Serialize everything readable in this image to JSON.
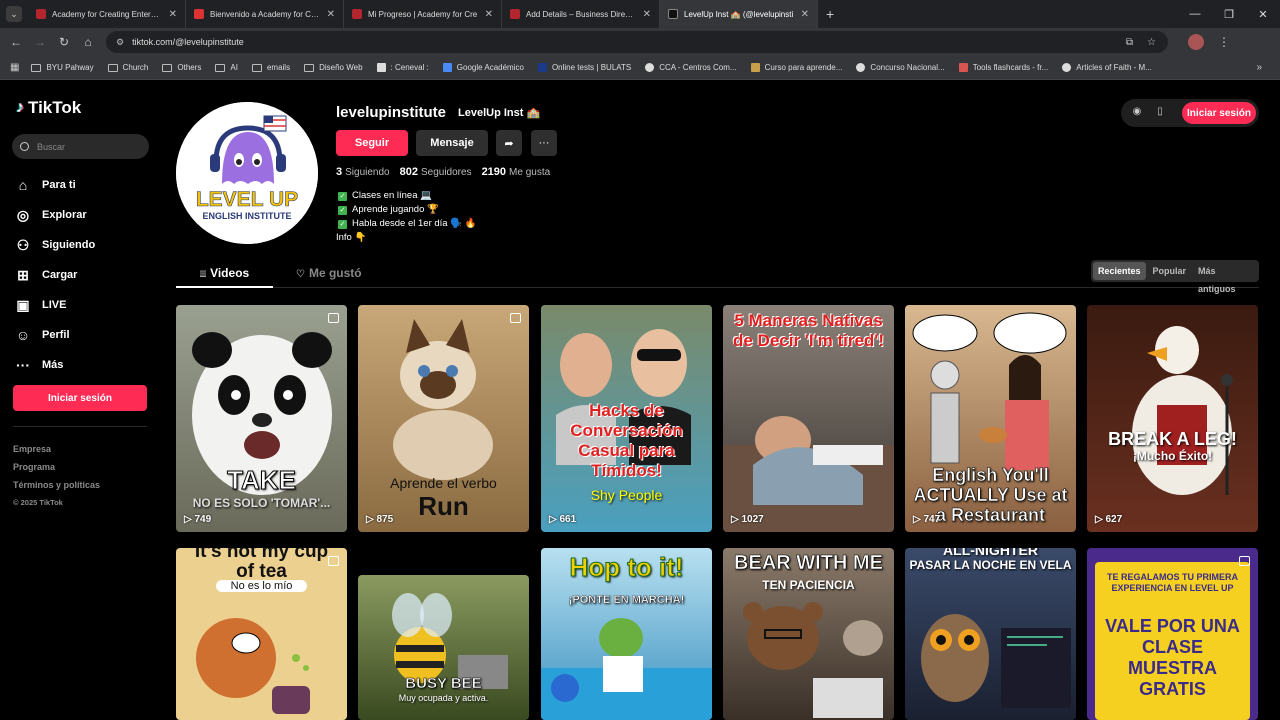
{
  "browser": {
    "tabs": [
      {
        "title": "Academy for Creating Enterprise"
      },
      {
        "title": "Bienvenido a Academy for Crea"
      },
      {
        "title": "Mi Progreso | Academy for Cre"
      },
      {
        "title": "Add Details – Business Director"
      },
      {
        "title": "LevelUp Inst 🏫 (@levelupinsti"
      }
    ],
    "url": "tiktok.com/@levelupinstitute",
    "bookmarks": [
      "BYU Pahway",
      "Church",
      "Others",
      "AI",
      "emails",
      "Diseño Web",
      ": Ceneval :",
      "Google Académico",
      "Online tests | BULATS",
      "CCA - Centros Com...",
      "Curso para aprende...",
      "Concurso Nacional...",
      "Tools flashcards - fr...",
      "Articles of Faith - M..."
    ]
  },
  "sidebar": {
    "logo": "TikTok",
    "search_placeholder": "Buscar",
    "nav": [
      {
        "label": "Para ti",
        "icon": "home-icon"
      },
      {
        "label": "Explorar",
        "icon": "compass-icon"
      },
      {
        "label": "Siguiendo",
        "icon": "following-icon"
      },
      {
        "label": "Cargar",
        "icon": "upload-icon"
      },
      {
        "label": "LIVE",
        "icon": "live-icon"
      },
      {
        "label": "Perfil",
        "icon": "profile-icon"
      },
      {
        "label": "Más",
        "icon": "more-icon"
      }
    ],
    "login": "Iniciar sesión",
    "footer": [
      "Empresa",
      "Programa",
      "Términos y políticas",
      "© 2025 TikTok"
    ]
  },
  "profile": {
    "handle": "levelupinstitute",
    "display_name": "LevelUp Inst 🏫",
    "follow": "Seguir",
    "message": "Mensaje",
    "following_count": "3",
    "following_label": "Siguiendo",
    "followers_count": "802",
    "followers_label": "Seguidores",
    "likes_count": "2190",
    "likes_label": "Me gusta",
    "bio": [
      "Clases en línea 💻",
      "Aprende jugando 🏆",
      "Habla desde el 1er día 🗣️ 🔥",
      "Info 👇"
    ],
    "avatar_text": [
      "LEVEL UP",
      "ENGLISH INSTITUTE"
    ]
  },
  "top_login": "Iniciar sesión",
  "tabs": {
    "videos": "Videos",
    "liked": "Me gustó"
  },
  "sort": [
    "Recientes",
    "Popular",
    "Más antiguos"
  ],
  "videos": [
    {
      "caption": "TAKE",
      "sub": "NO ES SOLO 'TOMAR'...",
      "views": "749",
      "bg": "#8a8a7a"
    },
    {
      "caption": "Aprende el verbo",
      "sub": "Run",
      "views": "875",
      "bg": "#b08a5a"
    },
    {
      "caption": "Hacks de Conversación Casual para Tímidos!",
      "sub": "Shy People",
      "views": "661",
      "bg": "#6a7a6a"
    },
    {
      "caption": "5 Maneras Nativas de Decir 'I'm tired'!",
      "sub": "",
      "views": "1027",
      "bg": "#5a5550"
    },
    {
      "caption": "English You'll ACTUALLY Use at a Restaurant",
      "sub": "",
      "views": "747",
      "bg": "#a0785a"
    },
    {
      "caption": "BREAK A LEG!",
      "sub": "¡Mucho Éxito!",
      "views": "627",
      "bg": "#5a3020"
    },
    {
      "caption": "It's not my cup of tea",
      "sub": "No es lo mío",
      "views": "",
      "bg": "#e8c880"
    },
    {
      "caption": "BUSY BEE",
      "sub": "Muy ocupada y activa.",
      "views": "",
      "bg": "#5a6a40"
    },
    {
      "caption": "Hop to it!",
      "sub": "¡PONTE EN MARCHA!",
      "views": "",
      "bg": "#5aa0c8"
    },
    {
      "caption": "BEAR WITH ME",
      "sub": "TEN PACIENCIA",
      "views": "",
      "bg": "#6a5a4a"
    },
    {
      "caption": "ALL-NIGHTER",
      "sub": "PASAR LA NOCHE EN VELA",
      "views": "",
      "bg": "#2a3040"
    },
    {
      "caption": "TE REGALAMOS TU PRIMERA EXPERIENCIA EN LEVEL UP",
      "sub": "VALE POR UNA CLASE MUESTRA GRATIS",
      "views": "",
      "bg": "#4a2a8a"
    }
  ]
}
